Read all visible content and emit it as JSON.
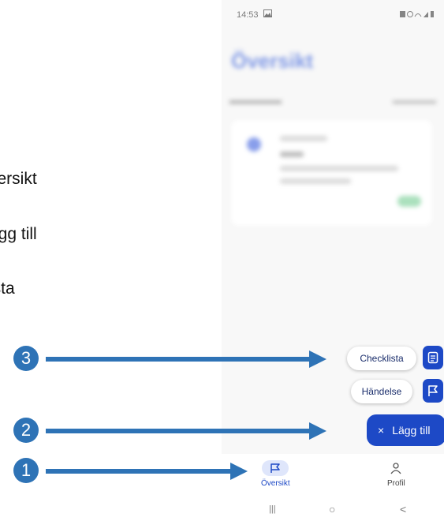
{
  "annotation_texts": [
    "versikt",
    "ägg till",
    "ista"
  ],
  "markers": [
    "3",
    "2",
    "1"
  ],
  "phone": {
    "status_time": "14:53",
    "title": "Översikt",
    "fab_menu": {
      "checklista_label": "Checklista",
      "handelse_label": "Händelse",
      "main_label": "Lägg till",
      "main_icon": "×"
    },
    "bottom_nav": {
      "items": [
        {
          "label": "Översikt",
          "icon": "flag-icon",
          "active": true
        },
        {
          "label": "Profil",
          "icon": "person-icon",
          "active": false
        }
      ]
    },
    "system_nav": {
      "recents": "|||",
      "home": "○",
      "back": "<"
    }
  },
  "colors": {
    "primary": "#1d49c6",
    "arrow": "#2e73b6",
    "nav_active_bg": "#dfe6fb"
  }
}
